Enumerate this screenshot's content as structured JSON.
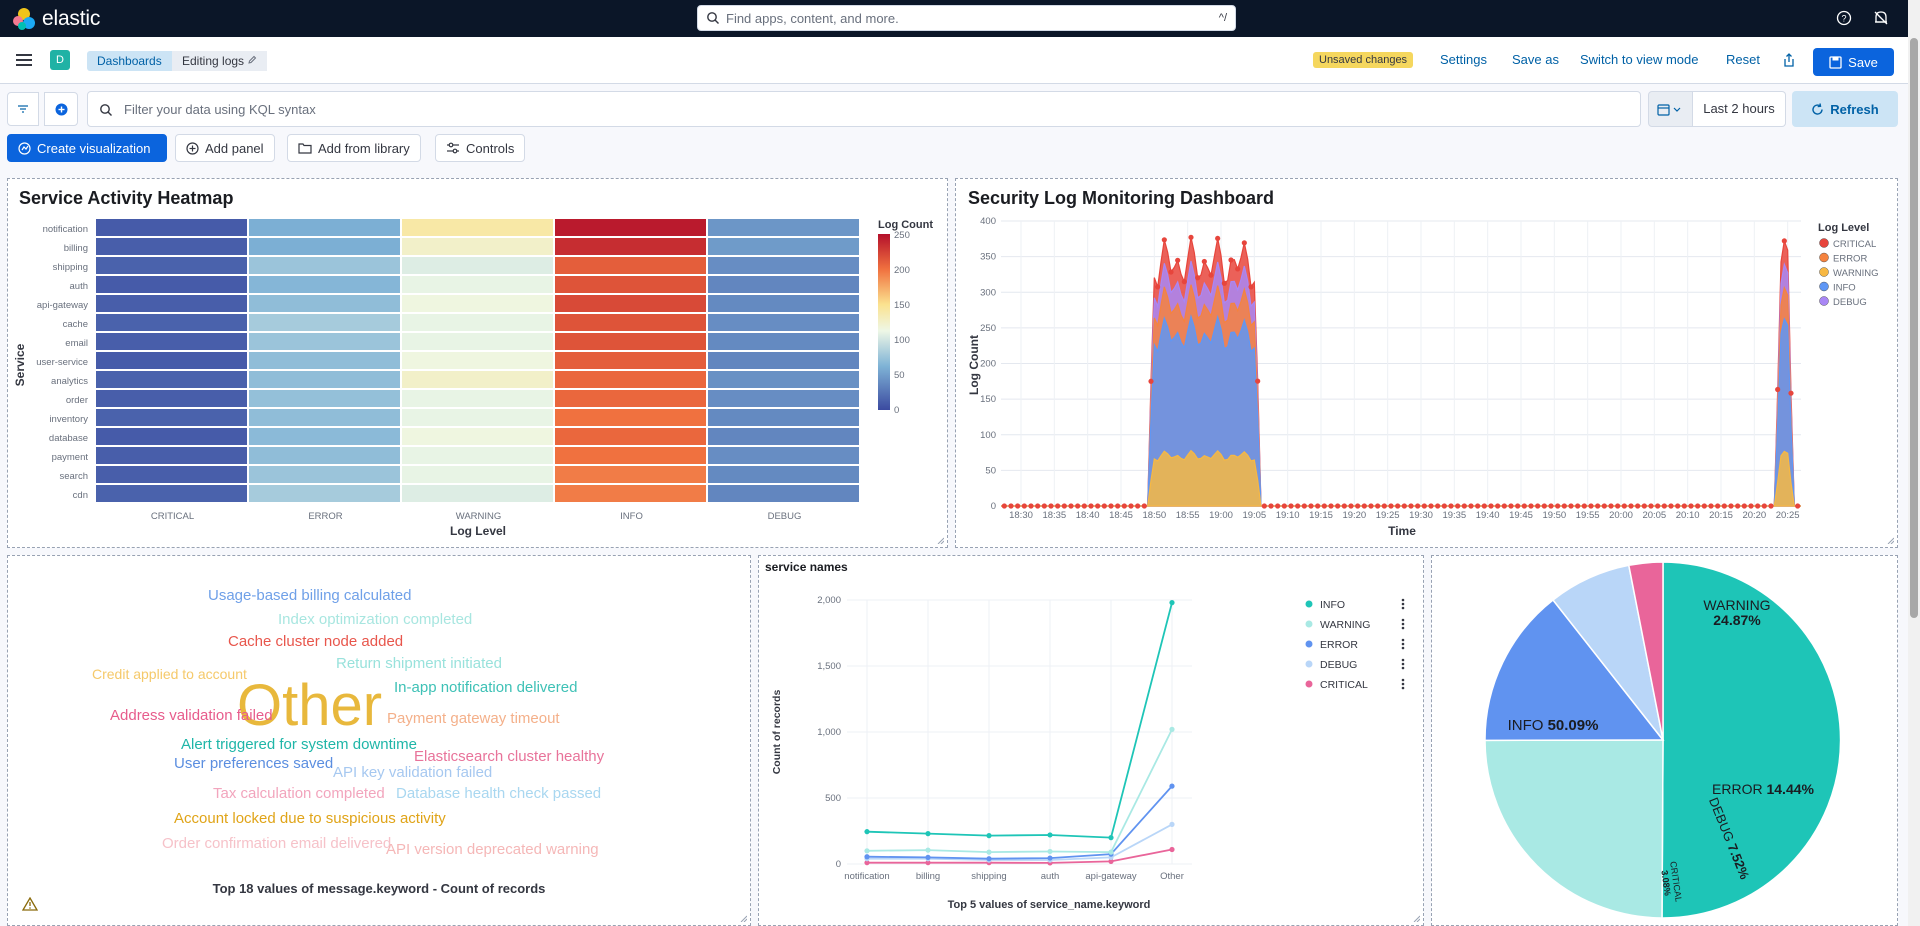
{
  "topbar": {
    "brand": "elastic",
    "search_placeholder": "Find apps, content, and more.",
    "search_shortcut": "^/"
  },
  "nav": {
    "space_avatar": "D",
    "breadcrumb": [
      "Dashboards",
      "Editing logs"
    ],
    "unsaved_badge": "Unsaved changes",
    "settings": "Settings",
    "save_as": "Save as",
    "switch_view": "Switch to view mode",
    "reset": "Reset",
    "save": "Save"
  },
  "query": {
    "placeholder": "Filter your data using KQL syntax",
    "date_range": "Last 2 hours",
    "refresh": "Refresh"
  },
  "toolbar": {
    "create": "Create visualization",
    "add_panel": "Add panel",
    "add_library": "Add from library",
    "controls": "Controls"
  },
  "heatmap": {
    "title": "Service Activity Heatmap",
    "ylabel": "Service",
    "xlabel": "Log Level",
    "legend_title": "Log Count",
    "legend_ticks": [
      "250",
      "200",
      "150",
      "100",
      "50",
      "0"
    ],
    "services": [
      "notification",
      "billing",
      "shipping",
      "auth",
      "api-gateway",
      "cache",
      "email",
      "user-service",
      "analytics",
      "order",
      "inventory",
      "database",
      "payment",
      "search",
      "cdn"
    ],
    "levels": [
      "CRITICAL",
      "ERROR",
      "WARNING",
      "INFO",
      "DEBUG"
    ],
    "colors": {
      "low": "#3f4fa3",
      "mid": "#f4f9dc",
      "high": "#b5122a"
    }
  },
  "security": {
    "title": "Security Log Monitoring Dashboard",
    "ylabel": "Log Count",
    "xlabel": "Time",
    "legend_title": "Log Level",
    "yticks": [
      "400",
      "350",
      "300",
      "250",
      "200",
      "150",
      "100",
      "50",
      "0"
    ],
    "xticks": [
      "18:30",
      "18:35",
      "18:40",
      "18:45",
      "18:50",
      "18:55",
      "19:00",
      "19:05",
      "19:10",
      "19:15",
      "19:20",
      "19:25",
      "19:30",
      "19:35",
      "19:40",
      "19:45",
      "19:50",
      "19:55",
      "20:00",
      "20:05",
      "20:10",
      "20:15",
      "20:20",
      "20:25"
    ],
    "legend": [
      {
        "name": "CRITICAL",
        "color": "#e7453c"
      },
      {
        "name": "ERROR",
        "color": "#f5833f"
      },
      {
        "name": "WARNING",
        "color": "#f7b843"
      },
      {
        "name": "INFO",
        "color": "#5f97f5"
      },
      {
        "name": "DEBUG",
        "color": "#a987f5"
      }
    ]
  },
  "wordcloud": {
    "caption": "Top 18 values of message.keyword - Count of records",
    "words": [
      {
        "text": "Usage-based billing calculated",
        "color": "#6fa0e8"
      },
      {
        "text": "Index optimization completed",
        "color": "#a8e6e0"
      },
      {
        "text": "Cache cluster node added",
        "color": "#e8564c"
      },
      {
        "text": "Credit applied to account",
        "color": "#f5c96a"
      },
      {
        "text": "Return shipment initiated",
        "color": "#99e2dc"
      },
      {
        "text": "Other",
        "color": "#e8b83c"
      },
      {
        "text": "In-app notification delivered",
        "color": "#3ec1b6"
      },
      {
        "text": "Address validation failed",
        "color": "#e75c8c"
      },
      {
        "text": "Payment gateway timeout",
        "color": "#f4b08a"
      },
      {
        "text": "Alert triggered for system downtime",
        "color": "#1fb6a8"
      },
      {
        "text": "Elasticsearch cluster healthy",
        "color": "#e8739a"
      },
      {
        "text": "User preferences saved",
        "color": "#5b8ee0"
      },
      {
        "text": "API key validation failed",
        "color": "#a6c8f0"
      },
      {
        "text": "Tax calculation completed",
        "color": "#f2a5bd"
      },
      {
        "text": "Database health check passed",
        "color": "#a9d7f0"
      },
      {
        "text": "Account locked due to suspicious activity",
        "color": "#e0a418"
      },
      {
        "text": "Order confirmation email delivered",
        "color": "#f6c2c9"
      },
      {
        "text": "API version deprecated warning",
        "color": "#f5b7b7"
      }
    ]
  },
  "service_names": {
    "title": "service names",
    "ylabel": "Count of records",
    "caption": "Top 5 values of service_name.keyword",
    "yticks": [
      "2,000",
      "1,500",
      "1,000",
      "500",
      "0"
    ],
    "legend": [
      {
        "name": "INFO",
        "color": "#1ec5b7"
      },
      {
        "name": "WARNING",
        "color": "#a9e9e4"
      },
      {
        "name": "ERROR",
        "color": "#6093f0"
      },
      {
        "name": "DEBUG",
        "color": "#b9d6f8"
      },
      {
        "name": "CRITICAL",
        "color": "#e9659a"
      }
    ]
  },
  "chart_data": [
    {
      "type": "line",
      "title": "service names",
      "ylabel": "Count of records",
      "categories": [
        "notification",
        "billing",
        "shipping",
        "auth",
        "api-gateway",
        "Other"
      ],
      "ylim": [
        0,
        2000
      ],
      "series": [
        {
          "name": "INFO",
          "values": [
            245,
            230,
            215,
            220,
            200,
            1980
          ]
        },
        {
          "name": "WARNING",
          "values": [
            100,
            105,
            90,
            95,
            90,
            1020
          ]
        },
        {
          "name": "ERROR",
          "values": [
            55,
            50,
            40,
            45,
            75,
            590
          ]
        },
        {
          "name": "DEBUG",
          "values": [
            40,
            40,
            30,
            30,
            50,
            300
          ]
        },
        {
          "name": "CRITICAL",
          "values": [
            10,
            10,
            10,
            8,
            20,
            110
          ]
        }
      ]
    },
    {
      "type": "pie",
      "slices": [
        {
          "label": "INFO",
          "value": 50.09,
          "text": "50.09%",
          "color": "#1ec5b7"
        },
        {
          "label": "WARNING",
          "value": 24.87,
          "text": "24.87%",
          "color": "#a9e9e4"
        },
        {
          "label": "ERROR",
          "value": 14.44,
          "text": "14.44%",
          "color": "#6093f0"
        },
        {
          "label": "DEBUG",
          "value": 7.52,
          "text": "7.52%",
          "color": "#b9d6f8"
        },
        {
          "label": "CRITICAL",
          "value": 3.08,
          "text": "3.08%",
          "color": "#e9659a"
        }
      ]
    },
    {
      "type": "heatmap",
      "title": "Service Activity Heatmap",
      "x": [
        "CRITICAL",
        "ERROR",
        "WARNING",
        "INFO",
        "DEBUG"
      ],
      "y": [
        "notification",
        "billing",
        "shipping",
        "auth",
        "api-gateway",
        "cache",
        "email",
        "user-service",
        "analytics",
        "order",
        "inventory",
        "database",
        "payment",
        "search",
        "cdn"
      ],
      "zlim": [
        0,
        250
      ],
      "values": [
        [
          10,
          60,
          140,
          245,
          45
        ],
        [
          12,
          60,
          125,
          235,
          48
        ],
        [
          14,
          75,
          105,
          210,
          40
        ],
        [
          10,
          65,
          110,
          215,
          36
        ],
        [
          12,
          70,
          115,
          220,
          38
        ],
        [
          14,
          80,
          110,
          215,
          40
        ],
        [
          12,
          75,
          110,
          215,
          38
        ],
        [
          10,
          70,
          115,
          210,
          36
        ],
        [
          14,
          70,
          125,
          205,
          42
        ],
        [
          12,
          72,
          110,
          205,
          40
        ],
        [
          14,
          70,
          110,
          200,
          38
        ],
        [
          10,
          68,
          115,
          205,
          36
        ],
        [
          12,
          70,
          110,
          200,
          40
        ],
        [
          12,
          75,
          110,
          195,
          38
        ],
        [
          14,
          80,
          105,
          195,
          36
        ]
      ]
    },
    {
      "type": "area",
      "title": "Security Log Monitoring Dashboard",
      "xlabel": "Time",
      "ylabel": "Log Count",
      "ylim": [
        0,
        400
      ],
      "x_range": [
        "18:27",
        "20:27"
      ],
      "bursts": [
        {
          "start": "18:49",
          "end": "19:06",
          "total_peak": 355
        },
        {
          "start": "20:23",
          "end": "20:26",
          "total_peak": 340
        }
      ],
      "series": [
        {
          "name": "WARNING",
          "burst_level": 70
        },
        {
          "name": "INFO",
          "burst_level": 240
        },
        {
          "name": "ERROR",
          "burst_level": 280
        },
        {
          "name": "DEBUG",
          "burst_level": 310
        },
        {
          "name": "CRITICAL",
          "burst_level": 340
        }
      ]
    }
  ]
}
